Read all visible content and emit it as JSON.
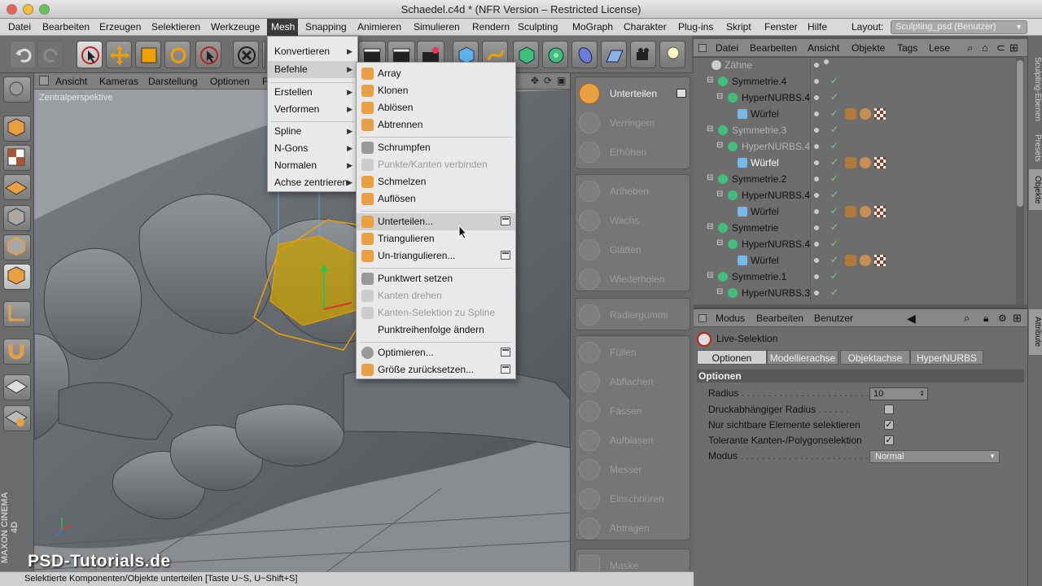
{
  "window": {
    "title": "Schaedel.c4d * (NFR Version – Restricted License)"
  },
  "menubar": {
    "items": [
      "Datei",
      "Bearbeiten",
      "Erzeugen",
      "Selektieren",
      "Werkzeuge",
      "Mesh",
      "Snapping",
      "Animieren",
      "Simulieren",
      "Rendern",
      "Sculpting",
      "MoGraph",
      "Charakter",
      "Plug-ins",
      "Skript",
      "Fenster",
      "Hilfe"
    ],
    "active": "Mesh",
    "layout_label": "Layout:",
    "layout_value": "Sculpting_psd (Benutzer)"
  },
  "viewport": {
    "menus": [
      "Ansicht",
      "Kameras",
      "Darstellung",
      "Optionen",
      "F"
    ],
    "label": "Zentralperspektive"
  },
  "mesh_menu": {
    "items": [
      {
        "label": "Konvertieren",
        "submenu": true
      },
      {
        "label": "Befehle",
        "submenu": true
      },
      {
        "label": "Erstellen",
        "submenu": true
      },
      {
        "label": "Verformen",
        "submenu": true
      },
      {
        "label": "Spline",
        "submenu": true
      },
      {
        "label": "N-Gons",
        "submenu": true
      },
      {
        "label": "Normalen",
        "submenu": true
      },
      {
        "label": "Achse zentrieren",
        "submenu": true
      }
    ]
  },
  "befehle_menu": {
    "items": [
      {
        "label": "Array",
        "disabled": false
      },
      {
        "label": "Klonen",
        "disabled": false
      },
      {
        "label": "Ablösen",
        "disabled": false
      },
      {
        "label": "Abtrennen",
        "disabled": false
      },
      {
        "label": "Schrumpfen",
        "disabled": false
      },
      {
        "label": "Punkte/Kanten verbinden",
        "disabled": true
      },
      {
        "label": "Schmelzen",
        "disabled": false
      },
      {
        "label": "Auflösen",
        "disabled": false
      },
      {
        "label": "Unterteilen...",
        "disabled": false
      },
      {
        "label": "Triangulieren",
        "disabled": false
      },
      {
        "label": "Un-triangulieren...",
        "disabled": false
      },
      {
        "label": "Punktwert setzen",
        "disabled": false
      },
      {
        "label": "Kanten drehen",
        "disabled": true
      },
      {
        "label": "Kanten-Selektion zu Spline",
        "disabled": true
      },
      {
        "label": "Punktreihenfolge ändern",
        "disabled": false
      },
      {
        "label": "Optimieren...",
        "disabled": false
      },
      {
        "label": "Größe zurücksetzen...",
        "disabled": false
      }
    ],
    "highlighted": "Unterteilen..."
  },
  "sculpt_panel": {
    "groups": [
      [
        "Unterteilen",
        "Verringern",
        "Erhöhen"
      ],
      [
        "Anheben",
        "Wachs",
        "Glätten",
        "Wiederholen"
      ],
      [
        "Radiergummi"
      ],
      [
        "Füllen",
        "Abflachen",
        "Fassen",
        "Aufblasen",
        "Messer",
        "Einschnüren",
        "Abtragen"
      ],
      [
        "Maske"
      ]
    ],
    "active": "Unterteilen"
  },
  "object_manager": {
    "menus": [
      "Datei",
      "Bearbeiten",
      "Ansicht",
      "Objekte",
      "Tags",
      "Lese"
    ],
    "rows": [
      {
        "name": "Zähne",
        "style": "grey",
        "indent": 0
      },
      {
        "name": "Symmetrie.4",
        "style": "normal",
        "indent": 1
      },
      {
        "name": "HyperNURBS.4",
        "style": "normal",
        "indent": 2
      },
      {
        "name": "Würfel",
        "style": "normal",
        "indent": 3,
        "tags": true
      },
      {
        "name": "Symmetrie.3",
        "style": "grey",
        "indent": 1
      },
      {
        "name": "HyperNURBS.4",
        "style": "grey",
        "indent": 2
      },
      {
        "name": "Würfel",
        "style": "white",
        "indent": 3,
        "tags": true
      },
      {
        "name": "Symmetrie.2",
        "style": "normal",
        "indent": 1
      },
      {
        "name": "HyperNURBS.4",
        "style": "normal",
        "indent": 2
      },
      {
        "name": "Würfel",
        "style": "normal",
        "indent": 3,
        "tags": true
      },
      {
        "name": "Symmetrie",
        "style": "normal",
        "indent": 1
      },
      {
        "name": "HyperNURBS.4",
        "style": "normal",
        "indent": 2
      },
      {
        "name": "Würfel",
        "style": "normal",
        "indent": 3,
        "tags": true
      },
      {
        "name": "Symmetrie.1",
        "style": "normal",
        "indent": 1
      },
      {
        "name": "HyperNURBS.3",
        "style": "normal",
        "indent": 2
      }
    ]
  },
  "side_tabs": [
    "Sculpting-Ebenen",
    "Presets",
    "Objekte",
    "Attribute"
  ],
  "attributes": {
    "menus": [
      "Modus",
      "Bearbeiten",
      "Benutzer"
    ],
    "tool_name": "Live-Selektion",
    "tabs": [
      "Optionen",
      "Modellierachse",
      "Objektachse",
      "HyperNURBS"
    ],
    "active_tab": "Optionen",
    "section": "Optionen",
    "fields": {
      "radius_label": "Radius",
      "radius_value": "10",
      "pressure_label": "Druckabhängiger Radius",
      "visible_label": "Nur sichtbare Elemente selektieren",
      "tolerant_label": "Tolerante Kanten-/Polygonselektion",
      "mode_label": "Modus",
      "mode_value": "Normal"
    },
    "checks": {
      "pressure": false,
      "visible": true,
      "tolerant": true
    }
  },
  "statusbar": {
    "text": "Selektierte Komponenten/Objekte unterteilen [Taste U~S, U~Shift+S]"
  },
  "branding": {
    "logo": "PSD-Tutorials.de",
    "vertical": "MAXON CINEMA 4D"
  },
  "colors": {
    "menu_active": "#3b3b3b",
    "accent_yellow": "#e8b400",
    "check_green": "#7ad37a"
  }
}
